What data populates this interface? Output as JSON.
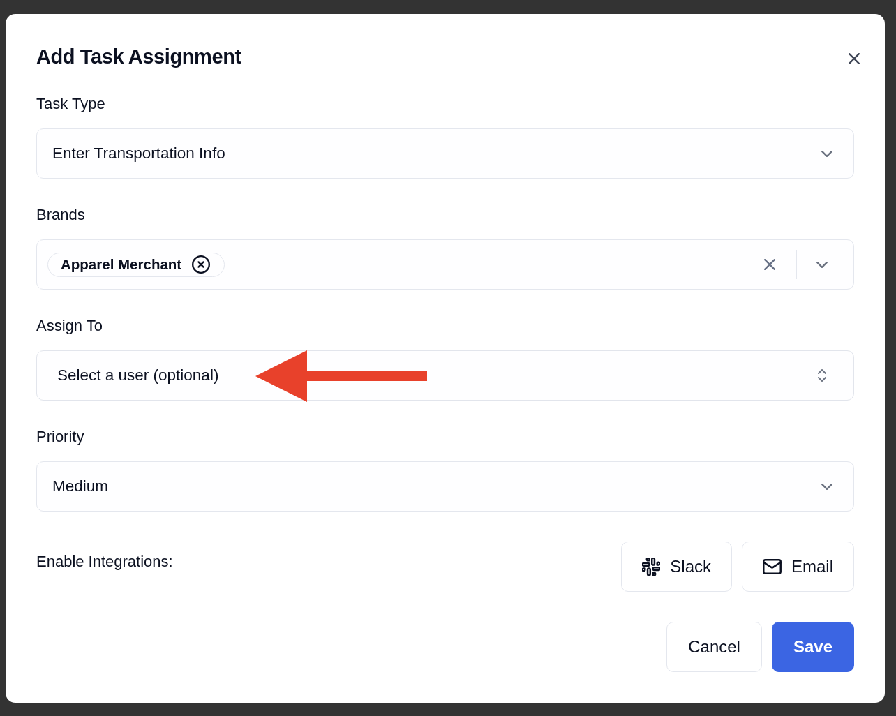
{
  "dialog": {
    "title": "Add Task Assignment"
  },
  "fields": [
    {
      "label": "Task Type",
      "kind": "select",
      "value": "Enter Transportation Info",
      "annotated": false
    },
    {
      "label": "Brands",
      "kind": "multiselect",
      "tags": [
        "Apparel Merchant"
      ],
      "annotated": false
    },
    {
      "label": "Assign To",
      "kind": "native_select",
      "value": "Select a user (optional)",
      "annotated": true
    },
    {
      "label": "Priority",
      "kind": "select",
      "value": "Medium",
      "annotated": false
    }
  ],
  "integrations": {
    "label": "Enable Integrations:",
    "buttons": [
      {
        "label": "Slack",
        "kind": "slack"
      },
      {
        "label": "Email",
        "kind": "email"
      }
    ]
  },
  "actions": [
    {
      "label": "Cancel",
      "kind": "secondary"
    },
    {
      "label": "Save",
      "kind": "primary"
    }
  ]
}
